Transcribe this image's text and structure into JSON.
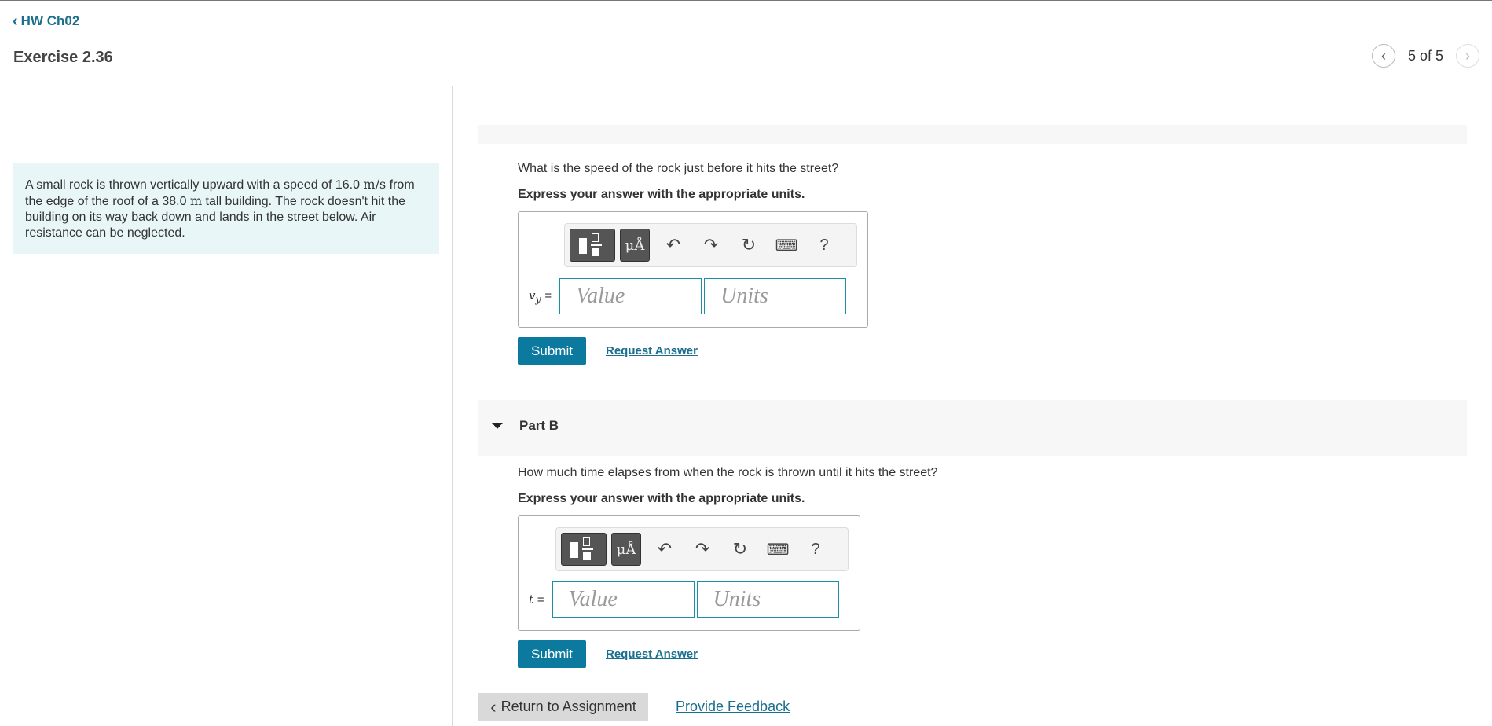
{
  "header": {
    "back_label": "HW Ch02",
    "title": "Exercise 2.36",
    "pager_text": "5 of 5"
  },
  "problem": {
    "text_1": "A small rock is thrown vertically upward with a speed of 16.0 ",
    "unit_1": "m/s",
    "text_2": " from the edge of the roof of a 38.0 ",
    "unit_2": "m",
    "text_3": " tall building. The rock doesn't hit the building on its way back down and lands in the street below. Air resistance can be neglected."
  },
  "parts": [
    {
      "question": "What is the speed of the rock just before it hits the street?",
      "instruction": "Express your answer with the appropriate units.",
      "variable": "v",
      "subscript": "y",
      "equals": "=",
      "value_placeholder": "Value",
      "units_placeholder": "Units",
      "submit_label": "Submit",
      "request_label": "Request Answer"
    },
    {
      "header_label": "Part B",
      "question": "How much time elapses from when the rock is thrown until it hits the street?",
      "instruction": "Express your answer with the appropriate units.",
      "variable": "t",
      "equals": "=",
      "value_placeholder": "Value",
      "units_placeholder": "Units",
      "submit_label": "Submit",
      "request_label": "Request Answer"
    }
  ],
  "toolbar": {
    "mu_label": "μÅ",
    "help_label": "?"
  },
  "footer": {
    "return_label": "Return to Assignment",
    "feedback_label": "Provide Feedback"
  }
}
